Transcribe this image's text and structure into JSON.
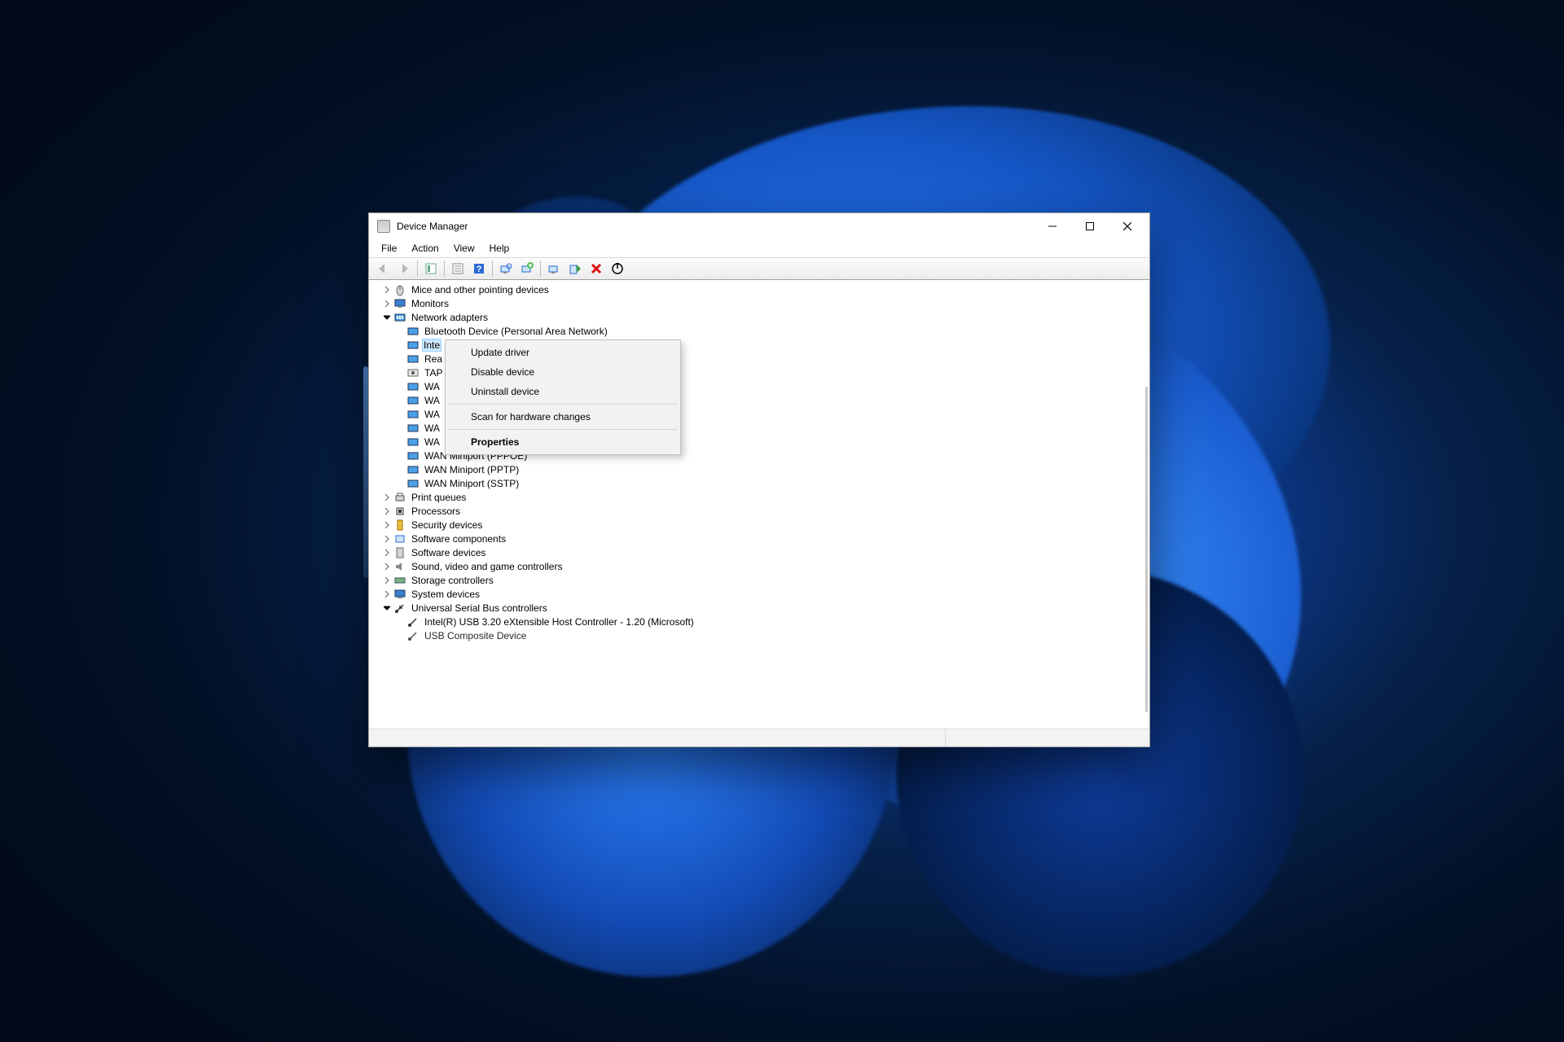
{
  "window": {
    "title": "Device Manager"
  },
  "menus": {
    "file": "File",
    "action": "Action",
    "view": "View",
    "help": "Help"
  },
  "tree": {
    "mice": "Mice and other pointing devices",
    "monitors": "Monitors",
    "network": "Network adapters",
    "net_items": {
      "bt": "Bluetooth Device (Personal Area Network)",
      "intel": "Inte",
      "realtek": "Rea",
      "tap": "TAP",
      "wan1": "WA",
      "wan2": "WA",
      "wan3": "WA",
      "wan4": "WA",
      "wan5": "WA",
      "wanpppoe": "WAN Miniport (PPPOE)",
      "wanpptp": "WAN Miniport (PPTP)",
      "wansstp": "WAN Miniport (SSTP)"
    },
    "print": "Print queues",
    "processors": "Processors",
    "security": "Security devices",
    "swcomp": "Software components",
    "swdev": "Software devices",
    "sound": "Sound, video and game controllers",
    "storage": "Storage controllers",
    "system": "System devices",
    "usb": "Universal Serial Bus controllers",
    "usb_items": {
      "xhci": "Intel(R) USB 3.20 eXtensible Host Controller - 1.20 (Microsoft)",
      "composite": "USB Composite Device"
    }
  },
  "context_menu": {
    "update": "Update driver",
    "disable": "Disable device",
    "uninstall": "Uninstall device",
    "scan": "Scan for hardware changes",
    "properties": "Properties"
  }
}
